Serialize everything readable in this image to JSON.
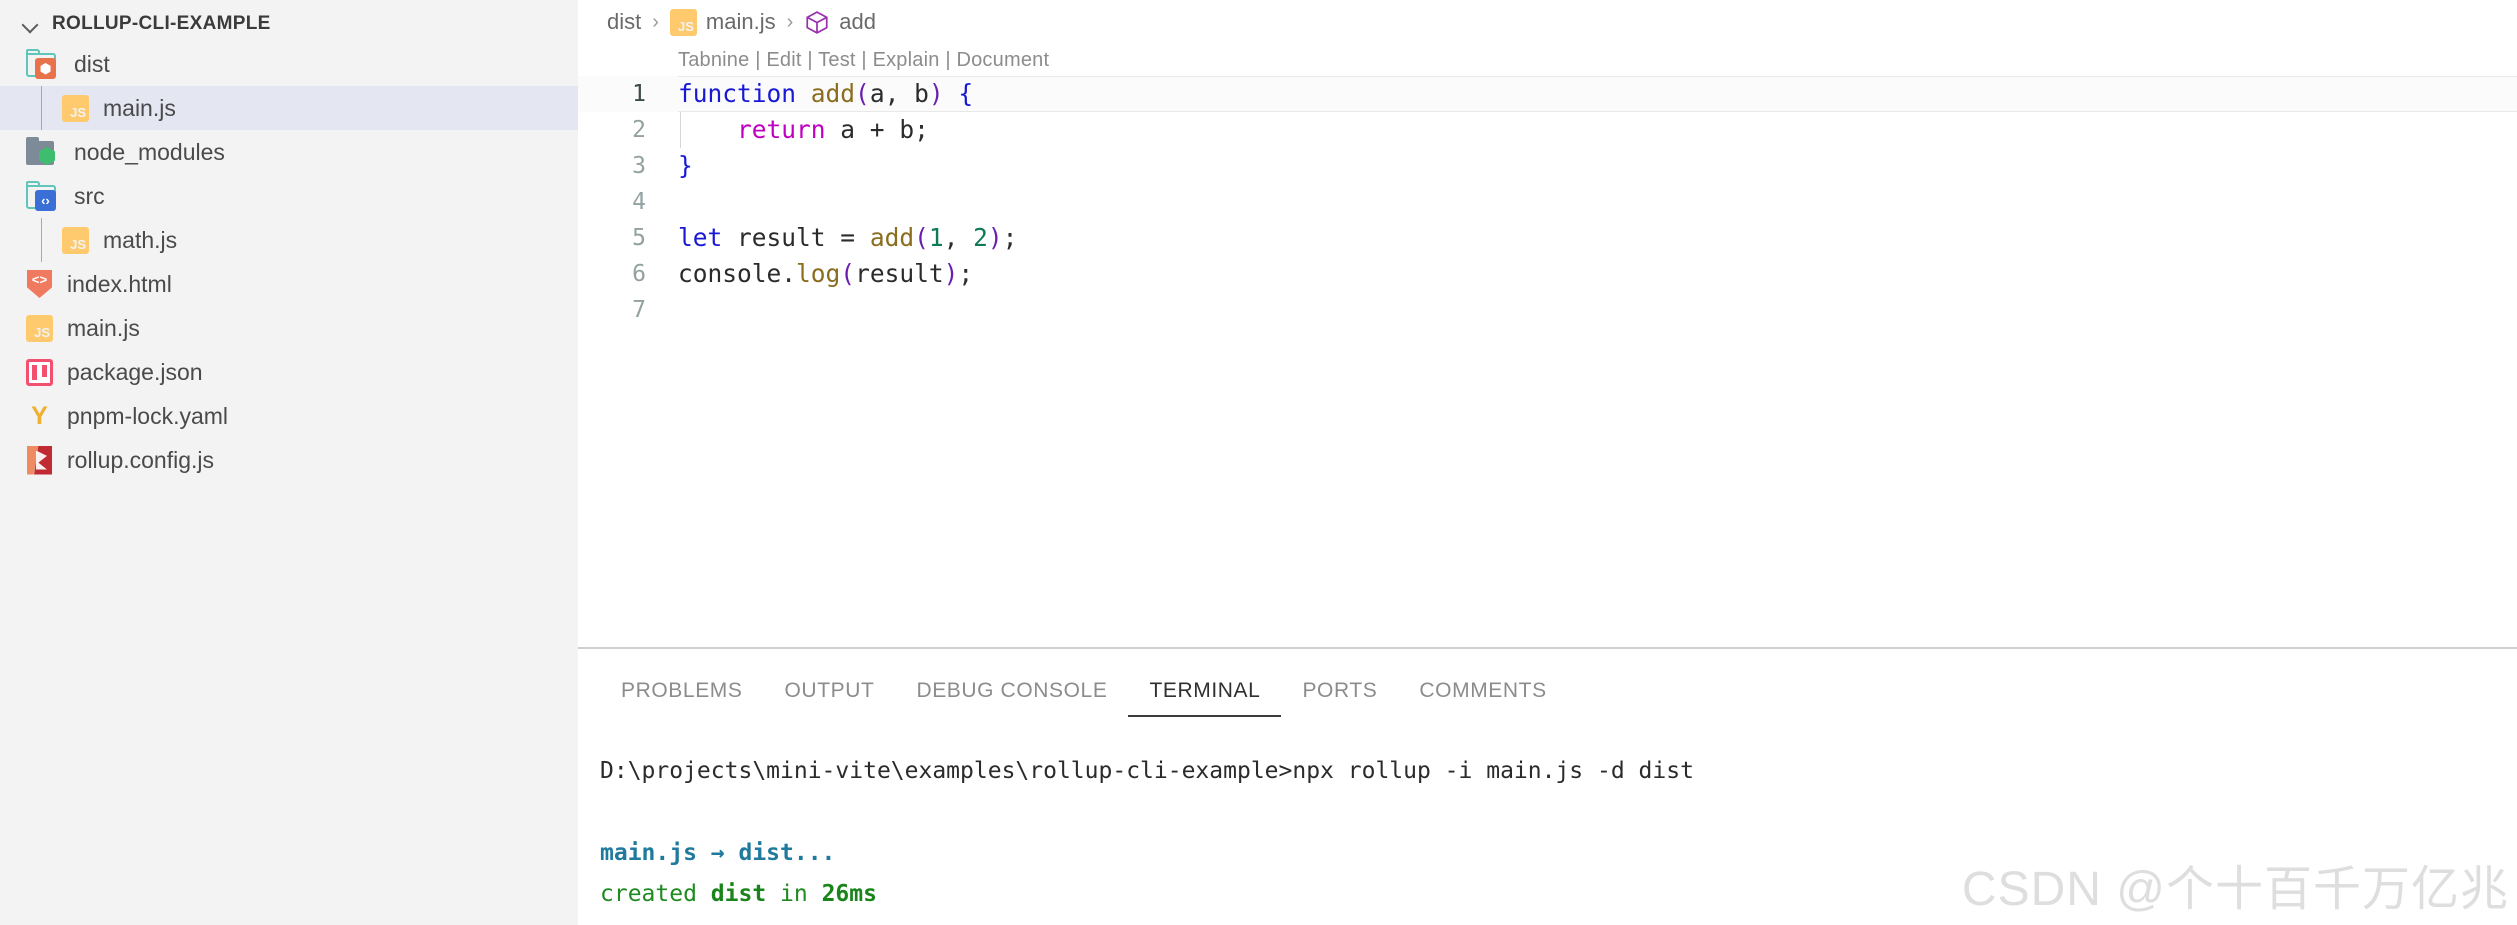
{
  "sidebar": {
    "root_label": "ROLLUP-CLI-EXAMPLE",
    "chevron_icon": "chevron-down-icon",
    "items": [
      {
        "label": "dist",
        "icon": "folder-dist-icon",
        "type": "folder",
        "indent": 0,
        "selected": false
      },
      {
        "label": "main.js",
        "icon": "js-file-icon",
        "type": "file",
        "indent": 1,
        "selected": true
      },
      {
        "label": "node_modules",
        "icon": "folder-node-icon",
        "type": "folder",
        "indent": 0,
        "selected": false
      },
      {
        "label": "src",
        "icon": "folder-src-icon",
        "type": "folder",
        "indent": 0,
        "selected": false
      },
      {
        "label": "math.js",
        "icon": "js-file-icon",
        "type": "file",
        "indent": 1,
        "selected": false
      },
      {
        "label": "index.html",
        "icon": "html-file-icon",
        "type": "file",
        "indent": 0,
        "selected": false
      },
      {
        "label": "main.js",
        "icon": "js-file-icon",
        "type": "file",
        "indent": 0,
        "selected": false
      },
      {
        "label": "package.json",
        "icon": "npm-file-icon",
        "type": "file",
        "indent": 0,
        "selected": false
      },
      {
        "label": "pnpm-lock.yaml",
        "icon": "yaml-file-icon",
        "type": "file",
        "indent": 0,
        "selected": false
      },
      {
        "label": "rollup.config.js",
        "icon": "rollup-file-icon",
        "type": "file",
        "indent": 0,
        "selected": false
      }
    ]
  },
  "editor": {
    "breadcrumb": {
      "separator": "›",
      "items": [
        {
          "label": "dist",
          "icon": null
        },
        {
          "label": "main.js",
          "icon": "js-file-icon"
        },
        {
          "label": "add",
          "icon": "symbol-cube-icon"
        }
      ]
    },
    "codelens": {
      "text": "Tabnine | Edit | Test | Explain | Document",
      "actions": [
        "Tabnine",
        "Edit",
        "Test",
        "Explain",
        "Document"
      ]
    },
    "active_line": 1,
    "lines": [
      {
        "n": "1",
        "tokens": [
          {
            "t": "function",
            "c": "t-kw"
          },
          {
            "t": " ",
            "c": "t-plain"
          },
          {
            "t": "add",
            "c": "t-fn"
          },
          {
            "t": "(",
            "c": "t-paren1"
          },
          {
            "t": "a",
            "c": "t-plain"
          },
          {
            "t": ",",
            "c": "t-punct"
          },
          {
            "t": " ",
            "c": "t-plain"
          },
          {
            "t": "b",
            "c": "t-plain"
          },
          {
            "t": ")",
            "c": "t-paren1"
          },
          {
            "t": " ",
            "c": "t-plain"
          },
          {
            "t": "{",
            "c": "t-brace"
          }
        ]
      },
      {
        "n": "2",
        "tokens": [
          {
            "t": "    ",
            "c": "t-plain"
          },
          {
            "t": "return",
            "c": "t-ret"
          },
          {
            "t": " a ",
            "c": "t-plain"
          },
          {
            "t": "+",
            "c": "t-plain"
          },
          {
            "t": " b",
            "c": "t-plain"
          },
          {
            "t": ";",
            "c": "t-punct"
          }
        ]
      },
      {
        "n": "3",
        "tokens": [
          {
            "t": "}",
            "c": "t-brace"
          }
        ]
      },
      {
        "n": "4",
        "tokens": [
          {
            "t": "",
            "c": "t-plain"
          }
        ]
      },
      {
        "n": "5",
        "tokens": [
          {
            "t": "let",
            "c": "t-kw"
          },
          {
            "t": " result ",
            "c": "t-plain"
          },
          {
            "t": "=",
            "c": "t-plain"
          },
          {
            "t": " ",
            "c": "t-plain"
          },
          {
            "t": "add",
            "c": "t-fn"
          },
          {
            "t": "(",
            "c": "t-paren1"
          },
          {
            "t": "1",
            "c": "t-num"
          },
          {
            "t": ",",
            "c": "t-punct"
          },
          {
            "t": " ",
            "c": "t-plain"
          },
          {
            "t": "2",
            "c": "t-num"
          },
          {
            "t": ")",
            "c": "t-paren1"
          },
          {
            "t": ";",
            "c": "t-punct"
          }
        ]
      },
      {
        "n": "6",
        "tokens": [
          {
            "t": "console",
            "c": "t-plain"
          },
          {
            "t": ".",
            "c": "t-punct"
          },
          {
            "t": "log",
            "c": "t-prop"
          },
          {
            "t": "(",
            "c": "t-paren1"
          },
          {
            "t": "result",
            "c": "t-plain"
          },
          {
            "t": ")",
            "c": "t-paren1"
          },
          {
            "t": ";",
            "c": "t-punct"
          }
        ]
      },
      {
        "n": "7",
        "tokens": [
          {
            "t": "",
            "c": "t-plain"
          }
        ]
      }
    ]
  },
  "panel": {
    "tabs": [
      {
        "label": "PROBLEMS",
        "active": false
      },
      {
        "label": "OUTPUT",
        "active": false
      },
      {
        "label": "DEBUG CONSOLE",
        "active": false
      },
      {
        "label": "TERMINAL",
        "active": true
      },
      {
        "label": "PORTS",
        "active": false
      },
      {
        "label": "COMMENTS",
        "active": false
      }
    ],
    "terminal": {
      "lines": [
        {
          "spans": [
            {
              "t": "D:\\projects\\mini-vite\\examples\\rollup-cli-example>npx rollup -i main.js -d dist",
              "c": "t-path"
            }
          ]
        },
        {
          "spans": [
            {
              "t": "",
              "c": "t-path"
            }
          ]
        },
        {
          "spans": [
            {
              "t": "main.js → dist...",
              "c": "t-blue"
            }
          ]
        },
        {
          "spans": [
            {
              "t": "created ",
              "c": "t-green"
            },
            {
              "t": "dist",
              "c": "t-green-b"
            },
            {
              "t": " in ",
              "c": "t-green"
            },
            {
              "t": "26ms",
              "c": "t-green-b"
            }
          ]
        }
      ]
    }
  },
  "watermark": {
    "text": "CSDN @个十百千万亿兆"
  },
  "colors": {
    "sidebar_bg": "#f3f3f3",
    "selection_bg": "#e4e6f1",
    "accent_js": "#ffca6e",
    "accent_folder": "#60c5ba",
    "terminal_blue": "#1f7a9e",
    "terminal_green": "#18841a"
  }
}
